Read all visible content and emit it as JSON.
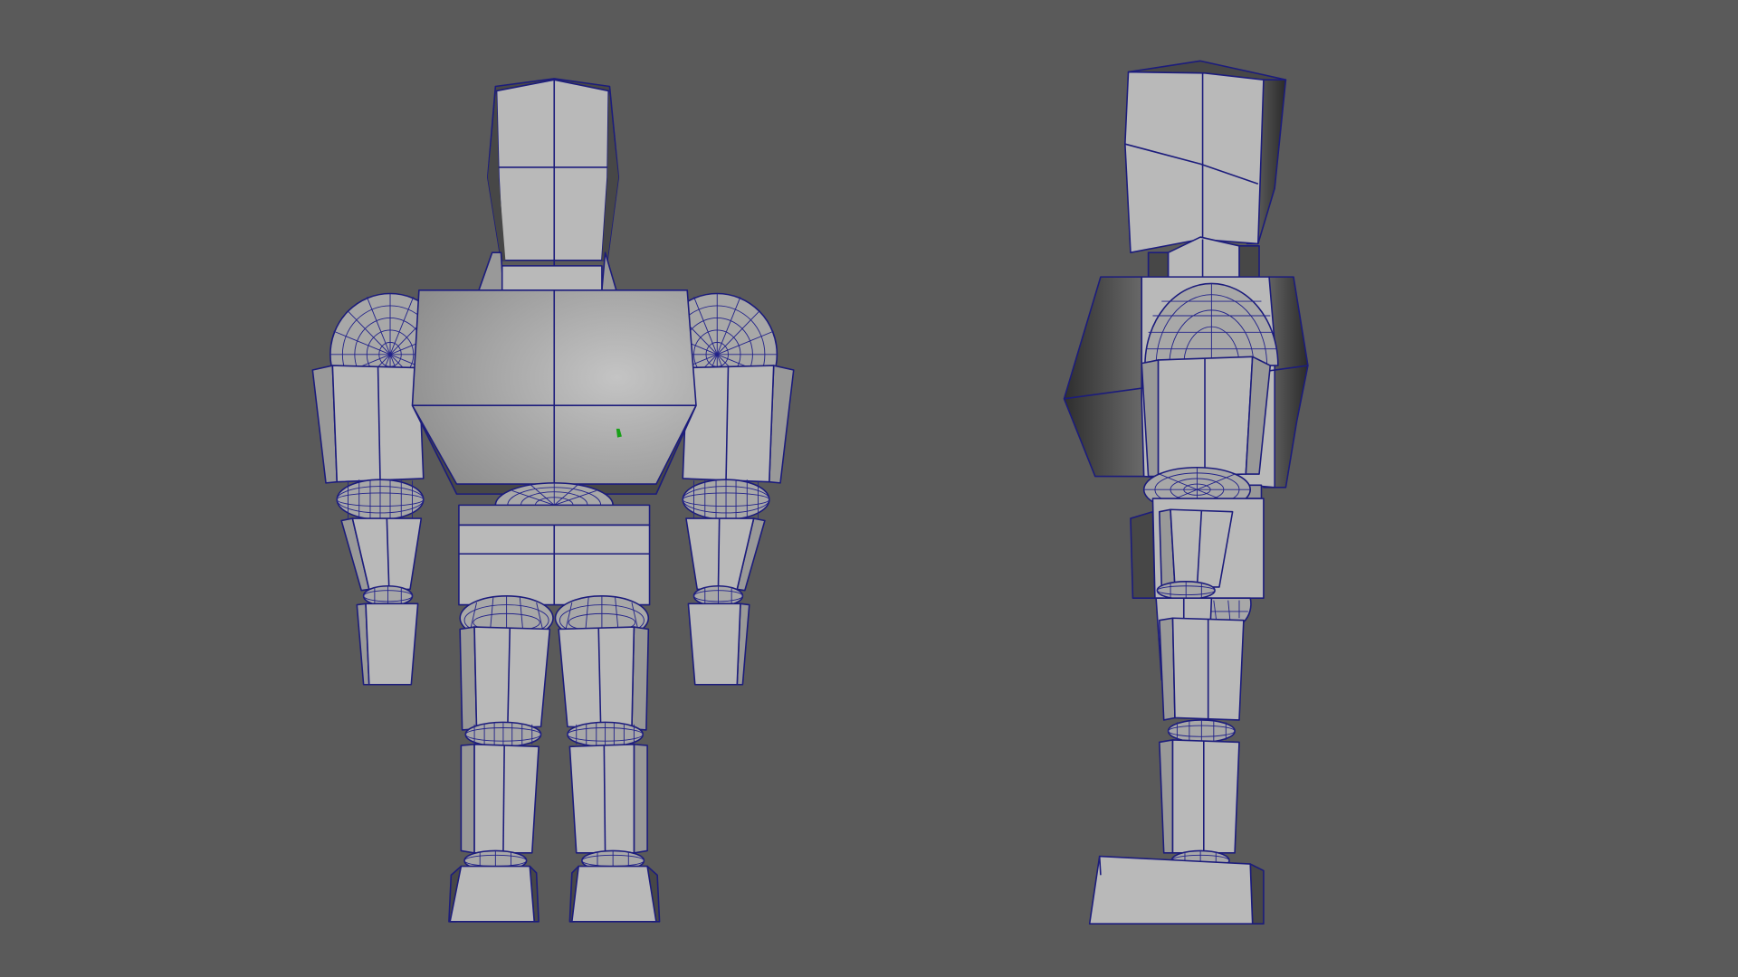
{
  "viewport": {
    "background": "#5a5a5a",
    "wireframe_color": "#1c1c7c",
    "display": "wireframe-on-shaded",
    "views": [
      {
        "name": "front"
      },
      {
        "name": "side"
      }
    ]
  },
  "model": {
    "type": "low-poly robot character",
    "parts": [
      "head",
      "neck",
      "torso",
      "pelvis",
      "shoulder-joints",
      "upper-arms",
      "elbow-joints",
      "forearms",
      "wrist-joints",
      "hands",
      "hip-joints",
      "thighs",
      "knee-joints",
      "shins",
      "ankle-joints",
      "feet"
    ]
  },
  "icons": [
    "selection-marker-icon"
  ],
  "colors": {
    "surface_light": "#b9b9b9",
    "surface_mid": "#999999",
    "surface_dark": "#474747",
    "selection_marker": "#18a018"
  }
}
